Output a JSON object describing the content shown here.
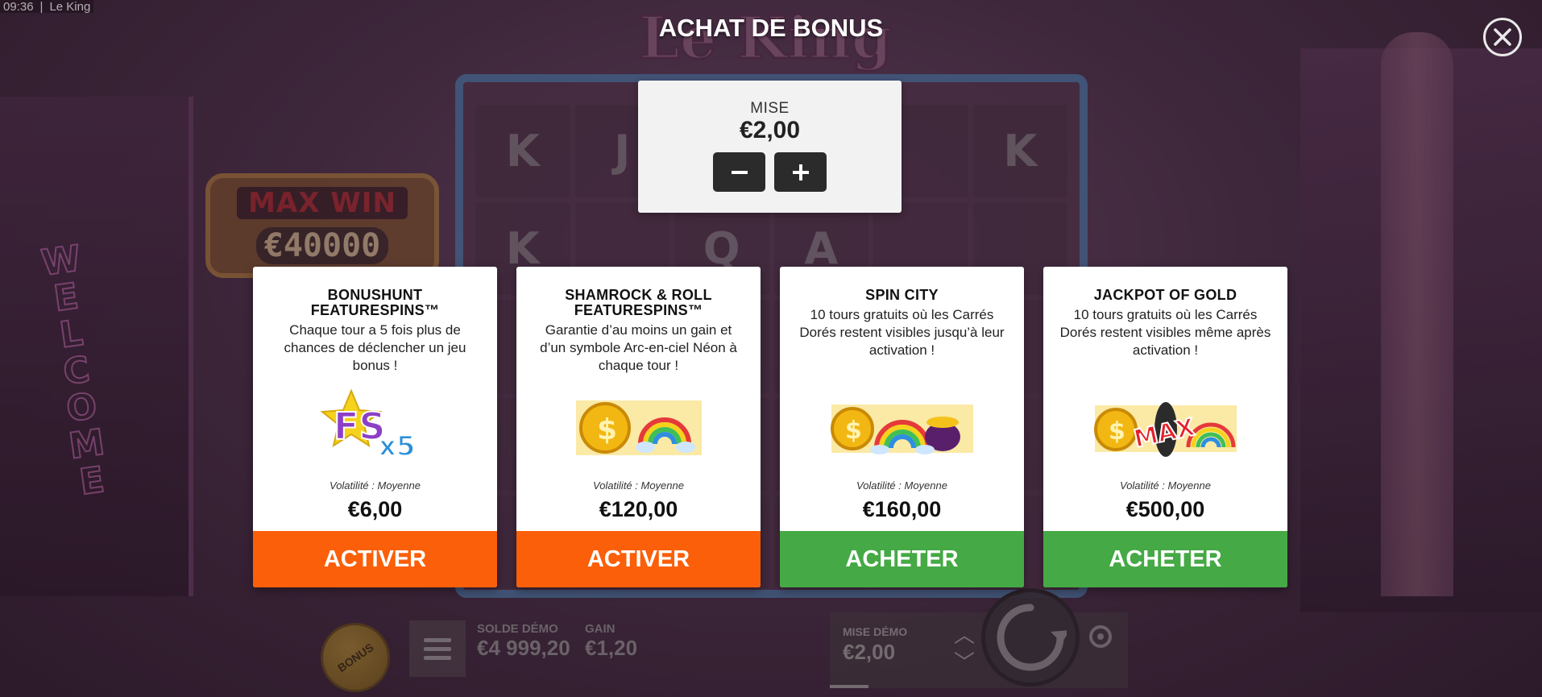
{
  "status_bar": {
    "time": "09:36",
    "app_name": "Le King"
  },
  "game": {
    "logo": "Le King",
    "max_win_label": "MAX WIN",
    "max_win_value": "€40000",
    "welcome_sign": [
      "W",
      "E",
      "L",
      "C",
      "O",
      "M",
      "E"
    ],
    "reel_symbols": [
      "K",
      "J",
      "",
      "",
      "",
      "K",
      "K",
      "",
      "Q",
      "A",
      "",
      "",
      "",
      "",
      "",
      "",
      "",
      "",
      "",
      "",
      "",
      "",
      "",
      "",
      "",
      "",
      "",
      "",
      "",
      ""
    ]
  },
  "dialog": {
    "title": "ACHAT DE BONUS",
    "close_icon": "close-icon",
    "stake": {
      "label": "MISE",
      "value": "€2,00",
      "minus": "−",
      "plus": "+"
    },
    "cards": [
      {
        "title": "BONUSHUNT FEATURESPINS™",
        "description": "Chaque tour a 5 fois plus de chances de déclencher un jeu bonus !",
        "art_text": "FS",
        "art_sub": "x5",
        "volatility": "Volatilité : Moyenne",
        "price": "€6,00",
        "button": "ACTIVER",
        "button_color": "#fb5f09"
      },
      {
        "title": "SHAMROCK & ROLL FEATURESPINS™",
        "description": "Garantie d’au moins un gain et d’un symbole Arc-en-ciel Néon à chaque tour !",
        "volatility": "Volatilité : Moyenne",
        "price": "€120,00",
        "button": "ACTIVER",
        "button_color": "#fb5f09"
      },
      {
        "title": "SPIN CITY",
        "description": "10 tours gratuits où les Carrés Dorés restent visibles jusqu’à leur activation !",
        "volatility": "Volatilité : Moyenne",
        "price": "€160,00",
        "button": "ACHETER",
        "button_color": "#45a945"
      },
      {
        "title": "JACKPOT OF GOLD",
        "description": "10 tours gratuits où les Carrés Dorés restent visibles même après activation !",
        "art_text": "MAX",
        "volatility": "Volatilité : Moyenne",
        "price": "€500,00",
        "button": "ACHETER",
        "button_color": "#45a945"
      }
    ]
  },
  "bottom_bar": {
    "bonus_button": "BONUS",
    "balance_label": "SOLDE DÉMO",
    "balance_value": "€4 999,20",
    "win_label": "GAIN",
    "win_value": "€1,20",
    "stake_label": "MISE DÉMO",
    "stake_value": "€2,00"
  }
}
